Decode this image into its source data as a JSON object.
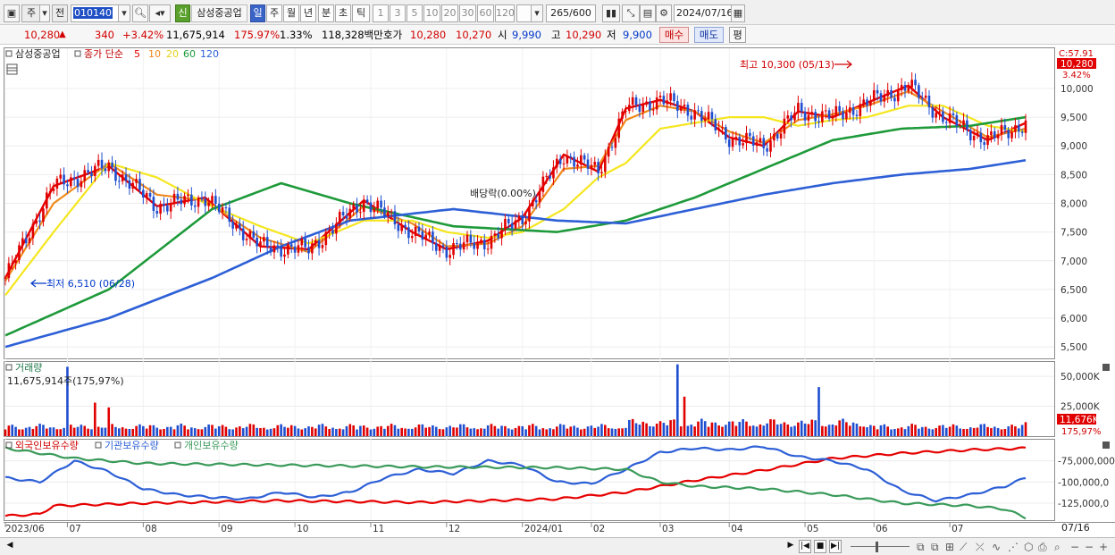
{
  "toolbar": {
    "market": "주",
    "period_type": "전",
    "code": "010140",
    "badge_new": "신",
    "stock_name": "삼성중공업",
    "periods": [
      "일",
      "주",
      "월",
      "년",
      "분",
      "초",
      "틱"
    ],
    "selected_period": "일",
    "intervals": [
      "1",
      "3",
      "5",
      "10",
      "20",
      "30",
      "60",
      "120"
    ],
    "count_display": "265/600",
    "date": "2024/07/16"
  },
  "quote": {
    "price": "10,280",
    "change_arrow": "▲",
    "change": "340",
    "change_pct": "+3.42%",
    "volume": "11,675,914",
    "volume_ratio": "175.97%",
    "turnover": "1.33%",
    "amount": "118,328백만",
    "ask_label": "호가",
    "ask": "10,280",
    "bid": "10,270",
    "open_label": "시",
    "open": "9,990",
    "high_label": "고",
    "high": "10,290",
    "low_label": "저",
    "low": "9,900",
    "buy_button": "매수",
    "sell_button": "매도",
    "eval_button": "평"
  },
  "legend": {
    "stock": "삼성중공업",
    "ma_title": "종가 단순",
    "periods": [
      "5",
      "10",
      "20",
      "60",
      "120"
    ]
  },
  "colors": {
    "ma5": "#e60000",
    "ma10": "#f08a1c",
    "ma20": "#f5e61e",
    "ma60": "#1e9a3a",
    "ma120": "#2d5fd6",
    "up": "#e00000",
    "down": "#1f4fd0",
    "foreign": "#e60000",
    "institution": "#2d5fd6",
    "individual": "#3a9a5a"
  },
  "chart_data": [
    {
      "type": "candlestick",
      "title": "삼성중공업",
      "x_range": [
        "2023/06/07",
        "2024/07/16"
      ],
      "x_ticks": [
        "2023/06",
        "07",
        "08",
        "09",
        "10",
        "11",
        "12",
        "2024/01",
        "02",
        "03",
        "04",
        "05",
        "06",
        "07"
      ],
      "x_end_label": "07/16",
      "y_ticks": [
        5500,
        6000,
        6500,
        7000,
        7500,
        8000,
        8500,
        9000,
        9500,
        10000
      ],
      "ylim": [
        5300,
        10700
      ],
      "series": [
        {
          "name": "5",
          "kind": "ma",
          "x": [
            0,
            14,
            30,
            44,
            58,
            74,
            88,
            104,
            118,
            128,
            140,
            150,
            162,
            172,
            180,
            190,
            200,
            210,
            220,
            230,
            240,
            250,
            262,
            272,
            285,
            296
          ],
          "values": [
            6700,
            8300,
            8650,
            7950,
            8100,
            7250,
            7200,
            8050,
            7500,
            7200,
            7350,
            7750,
            8850,
            8550,
            9650,
            9800,
            9600,
            9150,
            9000,
            9600,
            9500,
            9750,
            10050,
            9500,
            9100,
            9400
          ]
        },
        {
          "name": "10",
          "kind": "ma",
          "x": [
            0,
            14,
            30,
            44,
            58,
            74,
            88,
            104,
            118,
            128,
            140,
            150,
            162,
            172,
            180,
            190,
            200,
            210,
            220,
            230,
            240,
            250,
            262,
            272,
            285,
            296
          ],
          "values": [
            6650,
            8000,
            8700,
            8150,
            8050,
            7400,
            7150,
            7950,
            7650,
            7250,
            7300,
            7600,
            8600,
            8650,
            9450,
            9700,
            9600,
            9250,
            9050,
            9450,
            9550,
            9700,
            9950,
            9600,
            9150,
            9300
          ]
        },
        {
          "name": "20",
          "kind": "ma",
          "x": [
            0,
            14,
            30,
            44,
            58,
            74,
            88,
            104,
            118,
            128,
            140,
            150,
            162,
            172,
            180,
            190,
            200,
            210,
            220,
            230,
            240,
            250,
            262,
            272,
            285,
            296
          ],
          "values": [
            6400,
            7500,
            8700,
            8450,
            8000,
            7600,
            7300,
            7700,
            7700,
            7500,
            7400,
            7500,
            7900,
            8450,
            8700,
            9300,
            9400,
            9500,
            9500,
            9350,
            9450,
            9500,
            9700,
            9700,
            9350,
            9250
          ]
        },
        {
          "name": "60",
          "kind": "ma",
          "x": [
            0,
            30,
            60,
            80,
            100,
            130,
            160,
            180,
            200,
            220,
            240,
            260,
            280,
            296
          ],
          "values": [
            5700,
            6500,
            7900,
            8350,
            8000,
            7600,
            7500,
            7700,
            8100,
            8600,
            9100,
            9300,
            9350,
            9500
          ]
        },
        {
          "name": "120",
          "kind": "ma",
          "x": [
            0,
            30,
            60,
            80,
            100,
            130,
            160,
            180,
            200,
            220,
            240,
            260,
            280,
            296
          ],
          "values": [
            5500,
            6000,
            6700,
            7250,
            7700,
            7900,
            7700,
            7650,
            7900,
            8150,
            8350,
            8500,
            8600,
            8750
          ]
        }
      ],
      "annotations": [
        {
          "text": "최고 10,300 (05/13)",
          "value": 10300,
          "date": "05/13"
        },
        {
          "text": "최저 6,510 (06/28)",
          "value": 6510,
          "date": "06/28"
        },
        {
          "text": "배당락(0.00%)"
        }
      ],
      "price_box": {
        "value": "10,280",
        "pct": "3.42%",
        "c_label": "C:57.91"
      }
    },
    {
      "type": "bar",
      "title": "거래량",
      "readout": "11,675,914주(175,97%)",
      "y_ticks": [
        "50,000K",
        "25,000K"
      ],
      "current_label": "11,676K",
      "current_pct": "175,97%",
      "ylim": [
        0,
        62000
      ],
      "spikes": [
        {
          "x": 18,
          "value": 58000
        },
        {
          "x": 195,
          "value": 60000
        },
        {
          "x": 197,
          "value": 33000
        },
        {
          "x": 236,
          "value": 41000
        },
        {
          "x": 26,
          "value": 28000
        },
        {
          "x": 30,
          "value": 24000
        }
      ],
      "baseline_value": 9000
    },
    {
      "type": "line",
      "series_names": [
        "외국인보유수량",
        "기관보유수량",
        "개인보유수량"
      ],
      "y_ticks": [
        "-75,000,000",
        "-100,000,0",
        "-125,000,0"
      ],
      "ylim": [
        -145000000,
        -50000000
      ],
      "series": [
        {
          "name": "외국인보유수량",
          "x": [
            0,
            10,
            14,
            40,
            80,
            120,
            160,
            180,
            200,
            220,
            240,
            260,
            280,
            296
          ],
          "values": [
            -140000000,
            -138000000,
            -128000000,
            -125000000,
            -122000000,
            -124000000,
            -120000000,
            -112000000,
            -98000000,
            -86000000,
            -72000000,
            -66000000,
            -62000000,
            -60000000
          ]
        },
        {
          "name": "기관보유수량",
          "x": [
            0,
            10,
            20,
            30,
            40,
            50,
            60,
            70,
            80,
            90,
            100,
            110,
            120,
            130,
            140,
            150,
            160,
            170,
            180,
            190,
            200,
            210,
            220,
            230,
            240,
            250,
            260,
            270,
            280,
            290,
            296
          ],
          "values": [
            -95000000,
            -100000000,
            -75000000,
            -88000000,
            -108000000,
            -115000000,
            -118000000,
            -120000000,
            -112000000,
            -118000000,
            -112000000,
            -95000000,
            -85000000,
            -90000000,
            -75000000,
            -80000000,
            -100000000,
            -102000000,
            -85000000,
            -65000000,
            -60000000,
            -62000000,
            -58000000,
            -70000000,
            -75000000,
            -85000000,
            -110000000,
            -122000000,
            -115000000,
            -105000000,
            -95000000
          ]
        },
        {
          "name": "개인보유수량",
          "x": [
            0,
            20,
            40,
            80,
            120,
            160,
            180,
            190,
            200,
            220,
            240,
            260,
            280,
            290,
            296
          ],
          "values": [
            -60000000,
            -72000000,
            -78000000,
            -80000000,
            -82000000,
            -83000000,
            -85000000,
            -100000000,
            -105000000,
            -108000000,
            -115000000,
            -125000000,
            -128000000,
            -132000000,
            -142000000
          ]
        }
      ]
    }
  ]
}
